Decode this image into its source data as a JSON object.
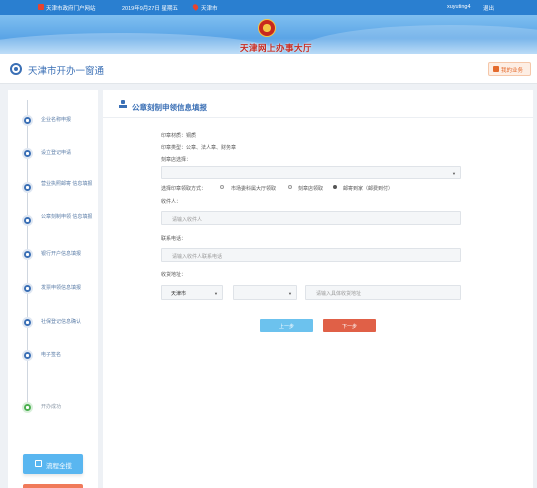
{
  "topbar": {
    "portal_link": "天津市政府门户网站",
    "date": "2019年9月27日 星期五",
    "city": "天津市",
    "username": "xuyuting4",
    "logout": "退出",
    "color": "#2a7fd0"
  },
  "banner": {
    "title": "天津网上办事大厅"
  },
  "header": {
    "title": "天津市开办一窗通",
    "my_business": "我的业务"
  },
  "steps": [
    {
      "label": "企业名称申报",
      "icon": "user-icon",
      "status": "active"
    },
    {
      "label": "设立登记申请",
      "icon": "building-icon",
      "status": "active"
    },
    {
      "label": "营业执照邮寄 信息填报",
      "icon": "document-icon",
      "status": "active"
    },
    {
      "label": "公章刻制申领 信息填报",
      "icon": "stamp-icon",
      "status": "active"
    },
    {
      "label": "银行开户信息填报",
      "icon": "bank-icon",
      "status": "active"
    },
    {
      "label": "发票申领信息填报",
      "icon": "invoice-icon",
      "status": "active"
    },
    {
      "label": "社保登记信息确认",
      "icon": "shield-icon",
      "status": "active"
    },
    {
      "label": "电子签名",
      "icon": "pen-icon",
      "status": "active"
    },
    {
      "label": "开办成功",
      "icon": "check-icon",
      "status": "done"
    }
  ],
  "flow_button": "流程全揽",
  "form": {
    "title": "公章刻制申领信息填报",
    "seal_material": "印章材质：铜质",
    "seal_types": "印章类型：公章、法人章、财务章",
    "shop_label": "刻章店选择：",
    "shop_value": "",
    "pickup_label": "选择印章领取方式：",
    "pickup_options": [
      "市场委科属大厅领取",
      "刻章店领取",
      "邮寄到家（邮费到付）"
    ],
    "pickup_selected": 2,
    "recipient_label": "收件人：",
    "recipient_placeholder": "请输入收件人",
    "phone_label": "联系电话：",
    "phone_placeholder": "请输入收件人联系电话",
    "address_label": "收货地址：",
    "city_value": "天津市",
    "district_value": "",
    "address_placeholder": "请输入具体收货地址",
    "prev_button": "上一步",
    "next_button": "下一步"
  }
}
